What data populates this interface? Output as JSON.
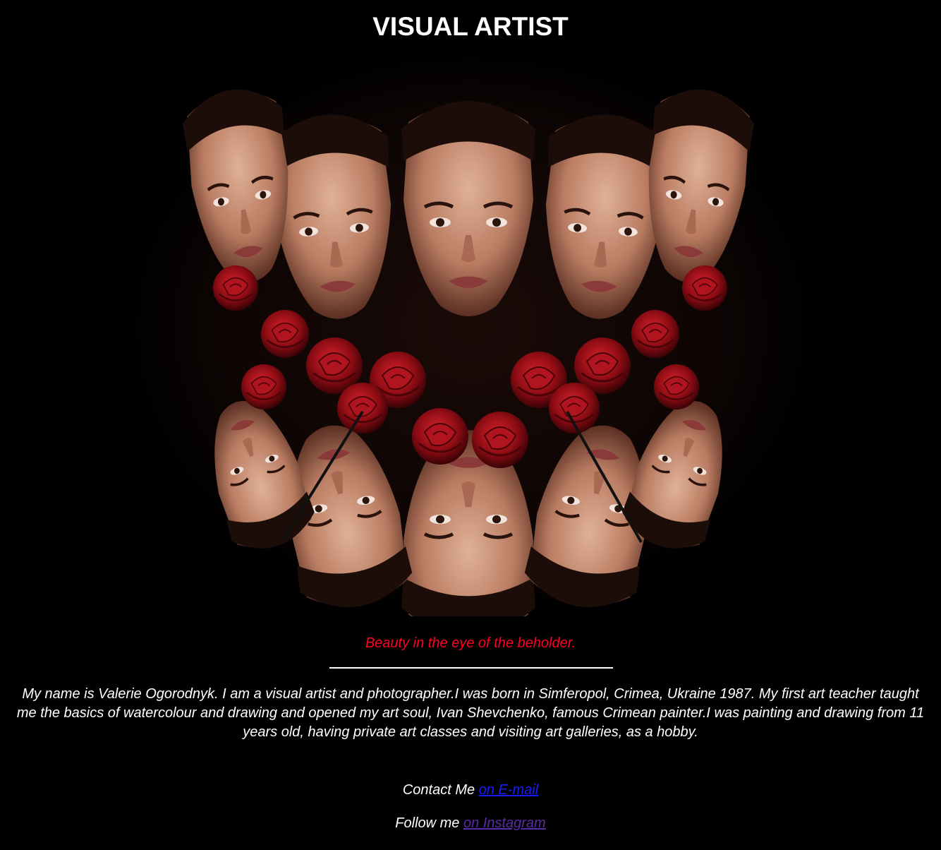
{
  "header": {
    "title": "VISUAL ARTIST"
  },
  "hero": {
    "icon": "kaleidoscope-portrait-with-roses"
  },
  "tagline": {
    "text": "Beauty in the eye of the beholder.",
    "color": "#ff0022"
  },
  "bio": {
    "text": "My name is Valerie Ogorodnyk. I am a visual artist and photographer.I was born in Simferopol, Crimea, Ukraine 1987. My first art teacher taught me the basics of watercolour and drawing and opened my art soul, Ivan Shevchenko, famous Crimean painter.I was painting and drawing from 11 years old, having private art classes and visiting art galleries, as a hobby."
  },
  "contact": {
    "email_prefix": "Contact Me ",
    "email_link": "on E-mail",
    "email_link_color": "#1a1aff",
    "instagram_prefix": "Follow me ",
    "instagram_link": "on Instagram",
    "instagram_link_color": "#5b2aa6"
  },
  "colors": {
    "background": "#000000",
    "text": "#ffffff"
  }
}
